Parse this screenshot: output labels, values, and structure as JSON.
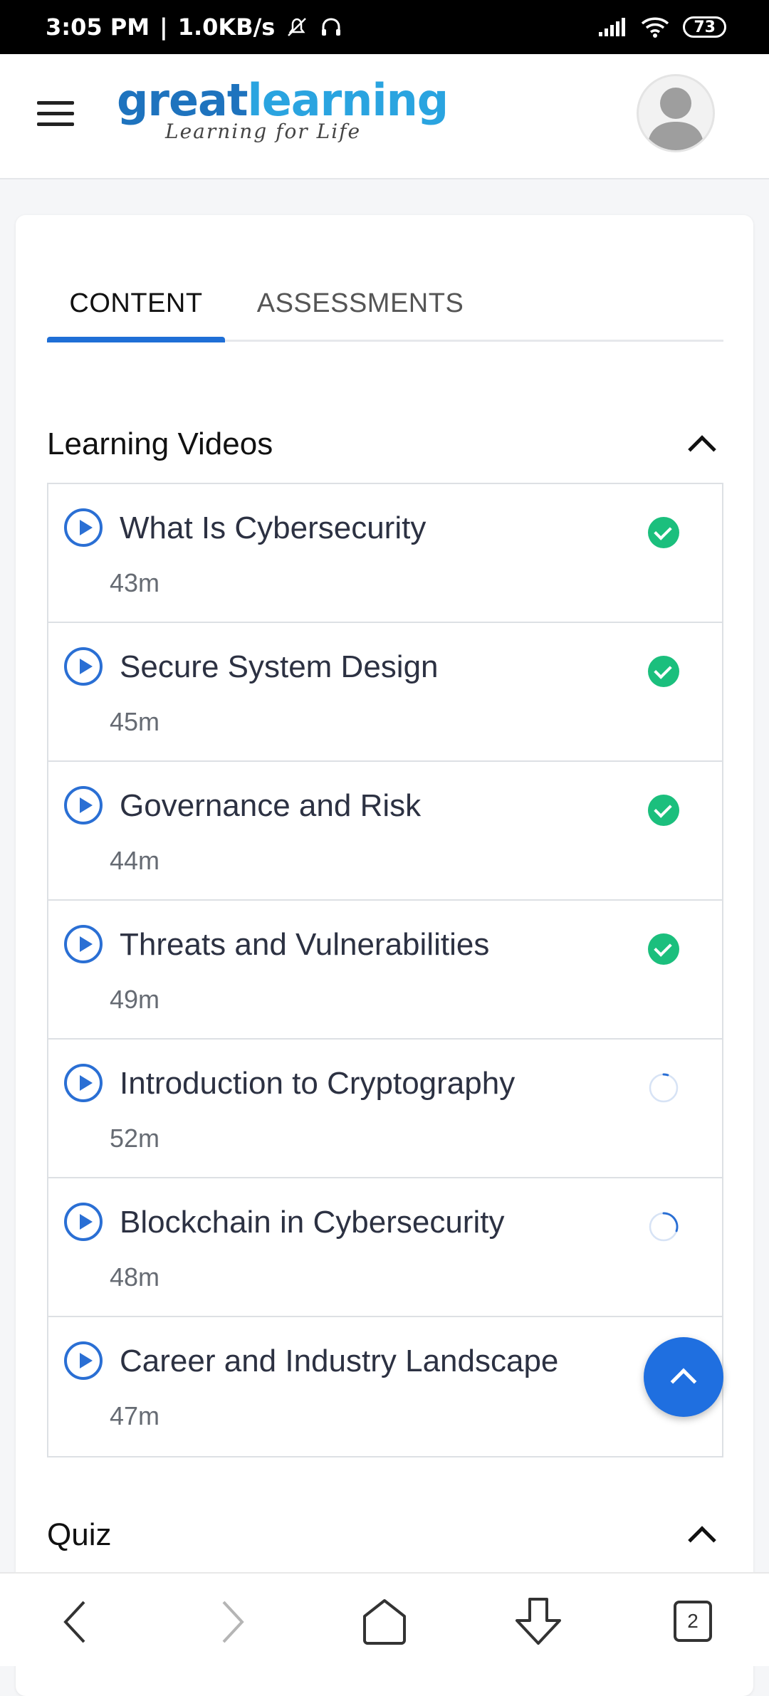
{
  "status_bar": {
    "time": "3:05 PM",
    "network_speed": "1.0KB/s",
    "battery": "73",
    "icons": [
      "bell-muted-icon",
      "headphones-icon",
      "signal-icon",
      "wifi-icon",
      "battery-icon"
    ]
  },
  "header": {
    "logo_part1": "great",
    "logo_part2": "learning",
    "logo_tagline": "Learning for Life",
    "brand_colors": [
      "#1e73be",
      "#2aa4e0"
    ]
  },
  "tabs": [
    {
      "label": "CONTENT",
      "active": true
    },
    {
      "label": "ASSESSMENTS",
      "active": false
    }
  ],
  "sections": {
    "learning_videos": {
      "title": "Learning Videos",
      "items": [
        {
          "title": "What Is Cybersecurity",
          "duration": "43m",
          "status": "completed"
        },
        {
          "title": "Secure System Design",
          "duration": "45m",
          "status": "completed"
        },
        {
          "title": "Governance and Risk",
          "duration": "44m",
          "status": "completed"
        },
        {
          "title": "Threats and Vulnerabilities",
          "duration": "49m",
          "status": "completed"
        },
        {
          "title": "Introduction to Cryptography",
          "duration": "52m",
          "status": "in-progress",
          "progress": 0.05
        },
        {
          "title": "Blockchain in Cybersecurity",
          "duration": "48m",
          "status": "in-progress",
          "progress": 0.3
        },
        {
          "title": "Career and Industry Landscape",
          "duration": "47m",
          "status": "not-started"
        }
      ]
    },
    "quiz": {
      "title": "Quiz"
    }
  },
  "nav_bar": {
    "tab_count": "2"
  },
  "colors": {
    "accent": "#1f6fd6",
    "completed": "#1bbf7d"
  }
}
